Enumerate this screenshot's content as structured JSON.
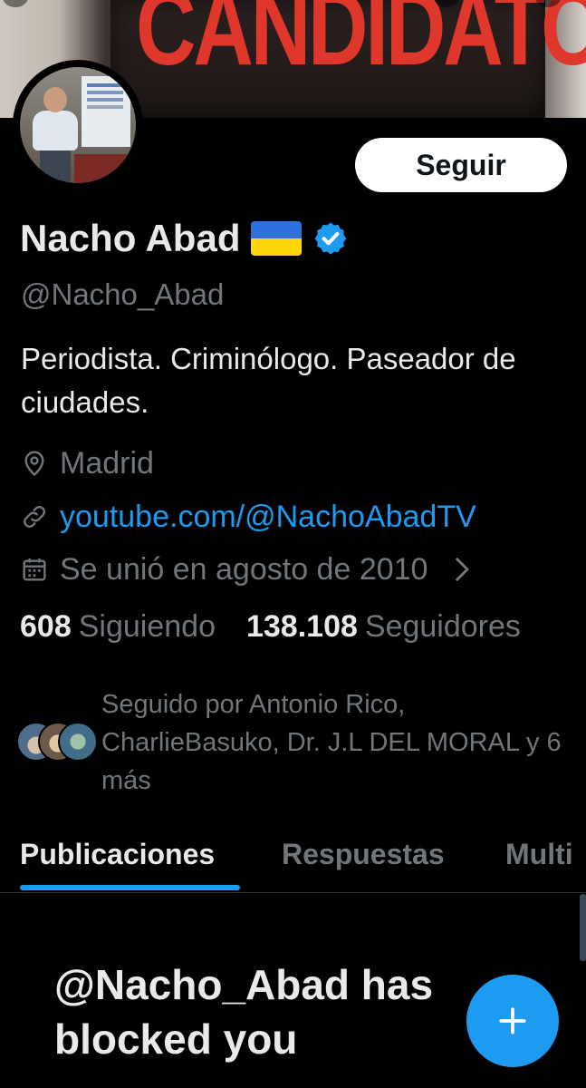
{
  "banner": {
    "text": "CANDIDATO"
  },
  "profile": {
    "follow_label": "Seguir",
    "display_name": "Nacho Abad",
    "handle": "@Nacho_Abad",
    "bio": "Periodista. Criminólogo. Paseador de ciudades.",
    "location": "Madrid",
    "website": "youtube.com/@NachoAbadTV",
    "joined": "Se unió en agosto de 2010",
    "following_count": "608",
    "following_label": "Siguiendo",
    "followers_count": "138.108",
    "followers_label": "Seguidores",
    "followed_by": "Seguido por Antonio Rico, CharlieBasuko, Dr. J.L DEL MORAL y 6 más"
  },
  "tabs": [
    {
      "label": "Publicaciones",
      "active": true
    },
    {
      "label": "Respuestas",
      "active": false
    },
    {
      "label": "Multi",
      "active": false
    }
  ],
  "blocked_message": "@Nacho_Abad has blocked you",
  "icons": {
    "flag": "ukraine-flag-icon",
    "verified": "verified-badge-icon",
    "location": "location-pin-icon",
    "link": "link-icon",
    "calendar": "calendar-icon",
    "chevron": "chevron-right-icon",
    "compose": "plus-icon"
  },
  "colors": {
    "background": "#000000",
    "text_primary": "#e7e9ea",
    "text_secondary": "#71767b",
    "accent": "#1d9bf0",
    "follow_button_bg": "#ffffff",
    "follow_button_text": "#0f1419"
  }
}
